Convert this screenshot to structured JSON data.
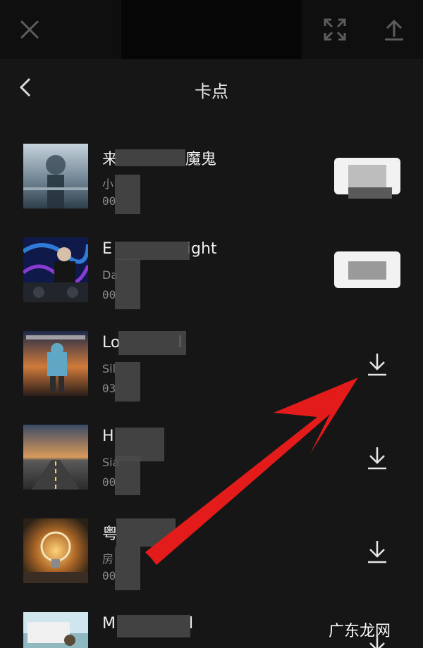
{
  "page": {
    "title": "卡点"
  },
  "topbar": {
    "icons": [
      "close-icon",
      "fullscreen-icon",
      "upload-icon"
    ]
  },
  "tracks": [
    {
      "title_start": "来",
      "title_end": "魔鬼",
      "artist": "小",
      "duration": "00",
      "action": "use"
    },
    {
      "title_start": "E",
      "title_end": "ight",
      "artist": "Da",
      "duration": "00",
      "action": "use"
    },
    {
      "title_start": "Lo",
      "title_end": "l",
      "artist": "Sil",
      "duration": "03",
      "action": "download"
    },
    {
      "title_start": "H",
      "title_end": "",
      "artist": "Sia",
      "duration": "00",
      "action": "download"
    },
    {
      "title_start": "粤",
      "title_end": "",
      "artist": "房",
      "duration": "00",
      "action": "download"
    },
    {
      "title_start": "M",
      "title_end": "l",
      "artist": "",
      "duration": "",
      "action": "download"
    }
  ],
  "watermark": "广东龙网",
  "colors": {
    "background": "#161616",
    "annotation_arrow": "#e31b1b",
    "text": "#eeeeee",
    "subtext": "#8b8b8b"
  }
}
